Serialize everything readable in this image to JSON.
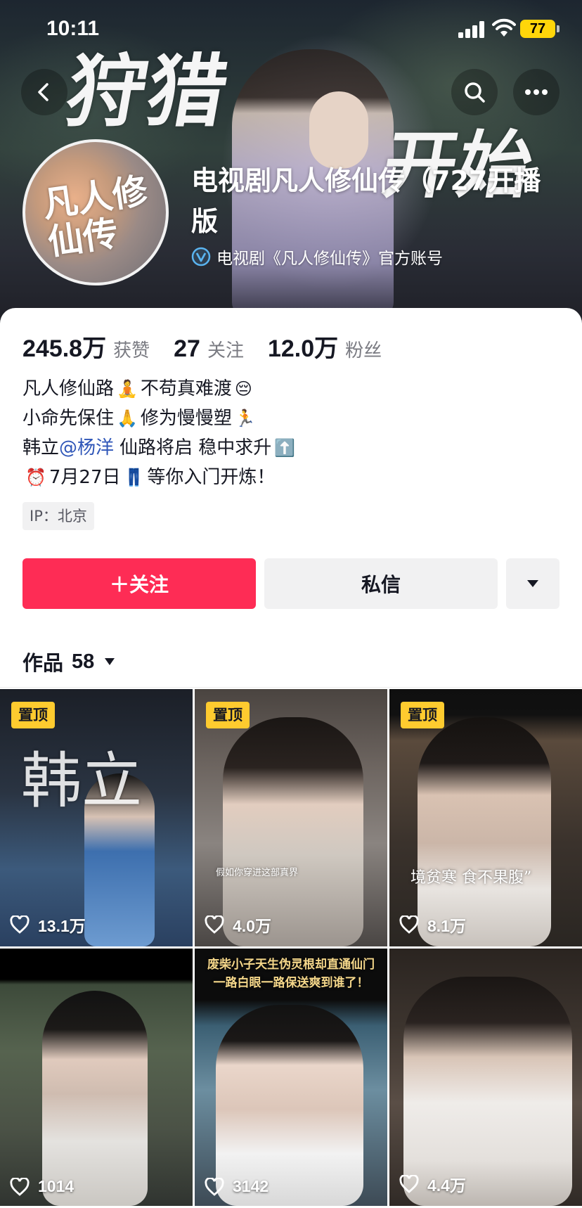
{
  "status_bar": {
    "time": "10:11",
    "battery": "77"
  },
  "banner": {
    "calligraphy_1": "狩猎",
    "calligraphy_2": "开始"
  },
  "nav": {
    "back_icon": "chevron-left-icon",
    "search_icon": "search-icon",
    "more_icon": "more-dots-icon"
  },
  "profile": {
    "avatar_text": "凡人修仙传",
    "name": "电视剧凡人修仙传（727开播版",
    "verified_text": "电视剧《凡人修仙传》官方账号"
  },
  "stats": [
    {
      "value": "245.8万",
      "label": "获赞"
    },
    {
      "value": "27",
      "label": "关注"
    },
    {
      "value": "12.0万",
      "label": "粉丝"
    }
  ],
  "bio": {
    "line1_a": "凡人修仙路",
    "line1_emoji": "🧘",
    "line1_b": "不苟真难渡",
    "line1_emoji2": "😔",
    "line2_a": "小命先保住",
    "line2_emoji": "🙏",
    "line2_b": "修为慢慢塑",
    "line2_emoji2": "🏃",
    "line3_a": "韩立",
    "line3_mention": "@杨洋",
    "line3_b": "仙路将启 稳中求升",
    "line3_emoji": "⬆️",
    "line4_emoji": "⏰",
    "line4_a": "7月27日",
    "line4_emoji2": "👖",
    "line4_b": "等你入门开炼！"
  },
  "ip_tag": "IP：北京",
  "actions": {
    "follow": "＋关注",
    "message": "私信"
  },
  "works_tab": {
    "label": "作品",
    "count": "58"
  },
  "pinned_label": "置顶",
  "videos": [
    {
      "likes": "13.1万",
      "pinned": true,
      "overlay": "韩立"
    },
    {
      "likes": "4.0万",
      "pinned": true,
      "overlay": "假如你穿进这部真界"
    },
    {
      "likes": "8.1万",
      "pinned": true,
      "overlay": "境贫寒 食不果腹”"
    },
    {
      "likes": "1014",
      "pinned": false,
      "overlay": ""
    },
    {
      "likes": "3142",
      "pinned": false,
      "overlay": "废柴小子天生伪灵根却直通仙门 一路白眼一路保送爽到谁了！"
    },
    {
      "likes": "4.4万",
      "pinned": false,
      "overlay": ""
    }
  ],
  "colors": {
    "follow": "#fe2c55",
    "pin": "#fecb2f",
    "mention": "#2f56b8"
  }
}
